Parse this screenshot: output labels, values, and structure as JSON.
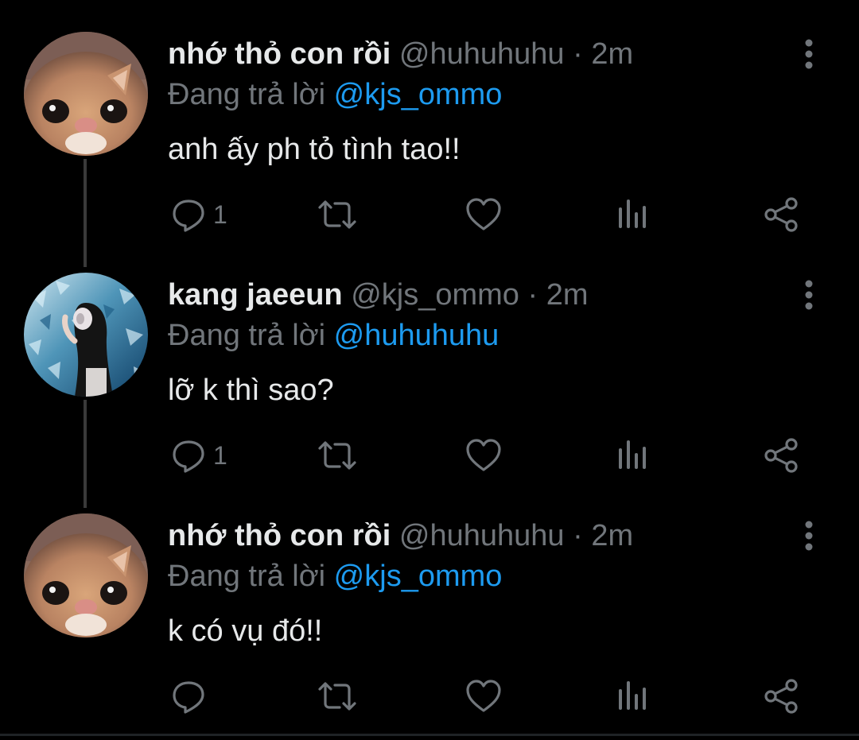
{
  "colors": {
    "background": "#000000",
    "name": "#e7e9ea",
    "secondary": "#71767b",
    "mention": "#1d9bf0",
    "thread_line": "#3a3a3a"
  },
  "tweets": [
    {
      "avatar": "cat-closeup-avatar",
      "name": "nhớ thỏ con rồi",
      "handle": "@huhuhuhu",
      "separator": "·",
      "time": "2m",
      "reply_prefix": "Đang trả lời",
      "reply_to": "@kjs_ommo",
      "text": "anh ấy ph tỏ tình tao!!",
      "reply_count": "1"
    },
    {
      "avatar": "aquarium-girl-avatar",
      "name": "kang jaeeun",
      "handle": "@kjs_ommo",
      "separator": "·",
      "time": "2m",
      "reply_prefix": "Đang trả lời",
      "reply_to": "@huhuhuhu",
      "text": "lỡ k thì sao?",
      "reply_count": "1"
    },
    {
      "avatar": "cat-closeup-avatar",
      "name": "nhớ thỏ con rồi",
      "handle": "@huhuhuhu",
      "separator": "·",
      "time": "2m",
      "reply_prefix": "Đang trả lời",
      "reply_to": "@kjs_ommo",
      "text": "k có vụ đó!!",
      "reply_count": ""
    }
  ],
  "icons": {
    "reply": "reply-icon",
    "retweet": "retweet-icon",
    "like": "heart-icon",
    "views": "views-icon",
    "share": "share-icon",
    "more": "more-vertical-icon"
  }
}
